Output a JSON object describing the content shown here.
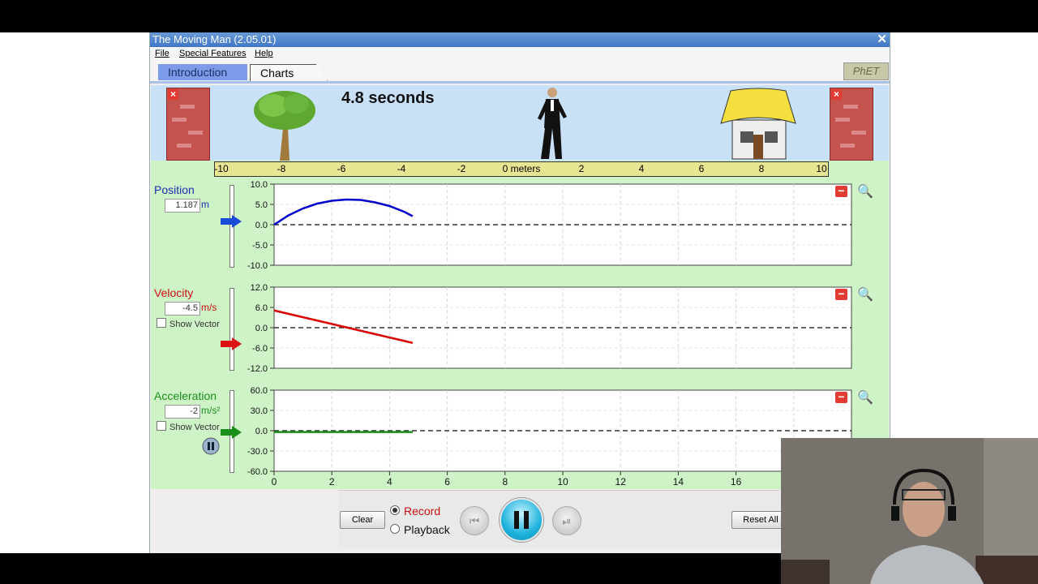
{
  "window": {
    "title": "The Moving Man (2.05.01)",
    "close": "✕"
  },
  "menu": {
    "file": "File",
    "special": "Special Features",
    "help": "Help"
  },
  "tabs": {
    "intro": "Introduction",
    "charts": "Charts"
  },
  "logo": "PhET",
  "scene": {
    "time_label": "4.8 seconds",
    "ruler_ticks": [
      "-10",
      "-8",
      "-6",
      "-4",
      "-2",
      "0 meters",
      "2",
      "4",
      "6",
      "8",
      "10"
    ]
  },
  "position": {
    "label": "Position",
    "value": "1.187",
    "unit": "m",
    "y_ticks": [
      "10.0",
      "5.0",
      "0.0",
      "-5.0",
      "-10.0"
    ]
  },
  "velocity": {
    "label": "Velocity",
    "value": "-4.5",
    "unit": "m/s",
    "show_vector": "Show Vector",
    "y_ticks": [
      "12.0",
      "6.0",
      "0.0",
      "-6.0",
      "-12.0"
    ]
  },
  "acceleration": {
    "label": "Acceleration",
    "value": "-2",
    "unit": "m/s²",
    "show_vector": "Show Vector",
    "y_ticks": [
      "60.0",
      "30.0",
      "0.0",
      "-30.0",
      "-60.0"
    ]
  },
  "x_axis_ticks": [
    "0",
    "2",
    "4",
    "6",
    "8",
    "10",
    "12",
    "14",
    "16"
  ],
  "controls": {
    "clear": "Clear",
    "record": "Record",
    "playback": "Playback",
    "reset": "Reset All"
  },
  "colors": {
    "position": "#0000cc",
    "velocity": "#dd0000",
    "acceleration": "#1a8f1a",
    "accent": "#4f7fd0"
  },
  "chart_data": [
    {
      "type": "line",
      "title": "Position",
      "ylabel": "Position (m)",
      "xlim": [
        0,
        20
      ],
      "ylim": [
        -10,
        10
      ],
      "series": [
        {
          "name": "Position",
          "x": [
            0,
            0.5,
            1,
            1.5,
            2,
            2.5,
            3,
            3.5,
            4,
            4.5,
            4.8
          ],
          "y": [
            0,
            2.3,
            4.0,
            5.2,
            5.9,
            6.2,
            6.1,
            5.5,
            4.6,
            3.2,
            2.1
          ]
        }
      ]
    },
    {
      "type": "line",
      "title": "Velocity",
      "ylabel": "Velocity (m/s)",
      "xlim": [
        0,
        20
      ],
      "ylim": [
        -12,
        12
      ],
      "series": [
        {
          "name": "Velocity",
          "x": [
            0,
            4.8
          ],
          "y": [
            5.1,
            -4.5
          ]
        }
      ]
    },
    {
      "type": "line",
      "title": "Acceleration",
      "ylabel": "Acceleration (m/s²)",
      "xlim": [
        0,
        20
      ],
      "ylim": [
        -60,
        60
      ],
      "series": [
        {
          "name": "Acceleration",
          "x": [
            0,
            4.8
          ],
          "y": [
            -2,
            -2
          ]
        }
      ]
    }
  ]
}
